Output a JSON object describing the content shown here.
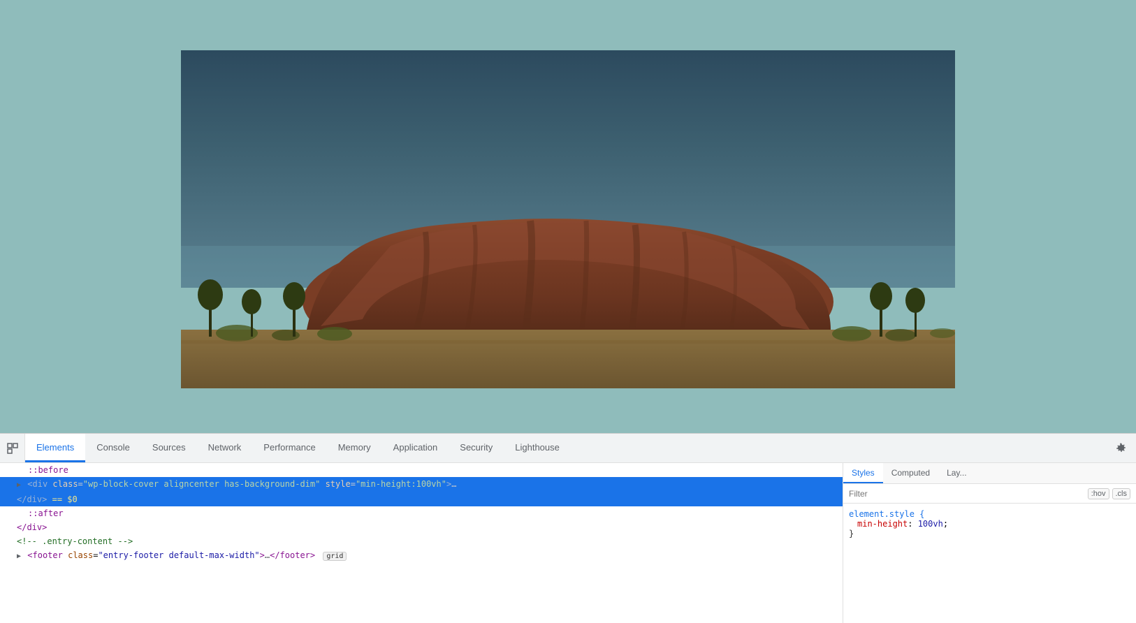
{
  "viewport": {
    "bg_color": "#8fbcbb"
  },
  "devtools": {
    "tabs": [
      {
        "id": "elements",
        "label": "Elements",
        "active": true
      },
      {
        "id": "console",
        "label": "Console",
        "active": false
      },
      {
        "id": "sources",
        "label": "Sources",
        "active": false
      },
      {
        "id": "network",
        "label": "Network",
        "active": false
      },
      {
        "id": "performance",
        "label": "Performance",
        "active": false
      },
      {
        "id": "memory",
        "label": "Memory",
        "active": false
      },
      {
        "id": "application",
        "label": "Application",
        "active": false
      },
      {
        "id": "security",
        "label": "Security",
        "active": false
      },
      {
        "id": "lighthouse",
        "label": "Lighthouse",
        "active": false
      }
    ],
    "html_lines": [
      {
        "id": "line1",
        "indent": 1,
        "content": "::before",
        "type": "pseudo",
        "selected": false
      },
      {
        "id": "line2",
        "indent": 1,
        "content_raw": "▶ <div class=\"wp-block-cover aligncenter has-background-dim\" style=\"min-height:100vh\">…",
        "selected": true
      },
      {
        "id": "line3",
        "indent": 1,
        "content_raw": "</div> == $0",
        "selected": true
      },
      {
        "id": "line4",
        "indent": 1,
        "content": "::after",
        "type": "pseudo",
        "selected": false
      },
      {
        "id": "line5",
        "indent": 1,
        "content_raw": "</div>",
        "selected": false
      },
      {
        "id": "line6",
        "indent": 1,
        "content_raw": "<!-- .entry-content -->",
        "type": "comment",
        "selected": false
      },
      {
        "id": "line7",
        "indent": 1,
        "content_raw": "▶ <footer class=\"entry-footer default-max-width\">…</footer>",
        "selected": false,
        "badge": "grid"
      }
    ],
    "styles_panel": {
      "tabs": [
        {
          "id": "styles",
          "label": "Styles",
          "active": true
        },
        {
          "id": "computed",
          "label": "Computed",
          "active": false
        },
        {
          "id": "layout",
          "label": "Lay...",
          "active": false
        }
      ],
      "filter_placeholder": "Filter",
      "filter_buttons": [
        ":hov",
        ".cls"
      ],
      "css_rules": [
        {
          "selector": "element.style {",
          "properties": [
            {
              "name": "min-height",
              "value": "100vh",
              "colon": ": ",
              "semicolon": ";"
            }
          ],
          "closing": "}"
        }
      ]
    }
  }
}
